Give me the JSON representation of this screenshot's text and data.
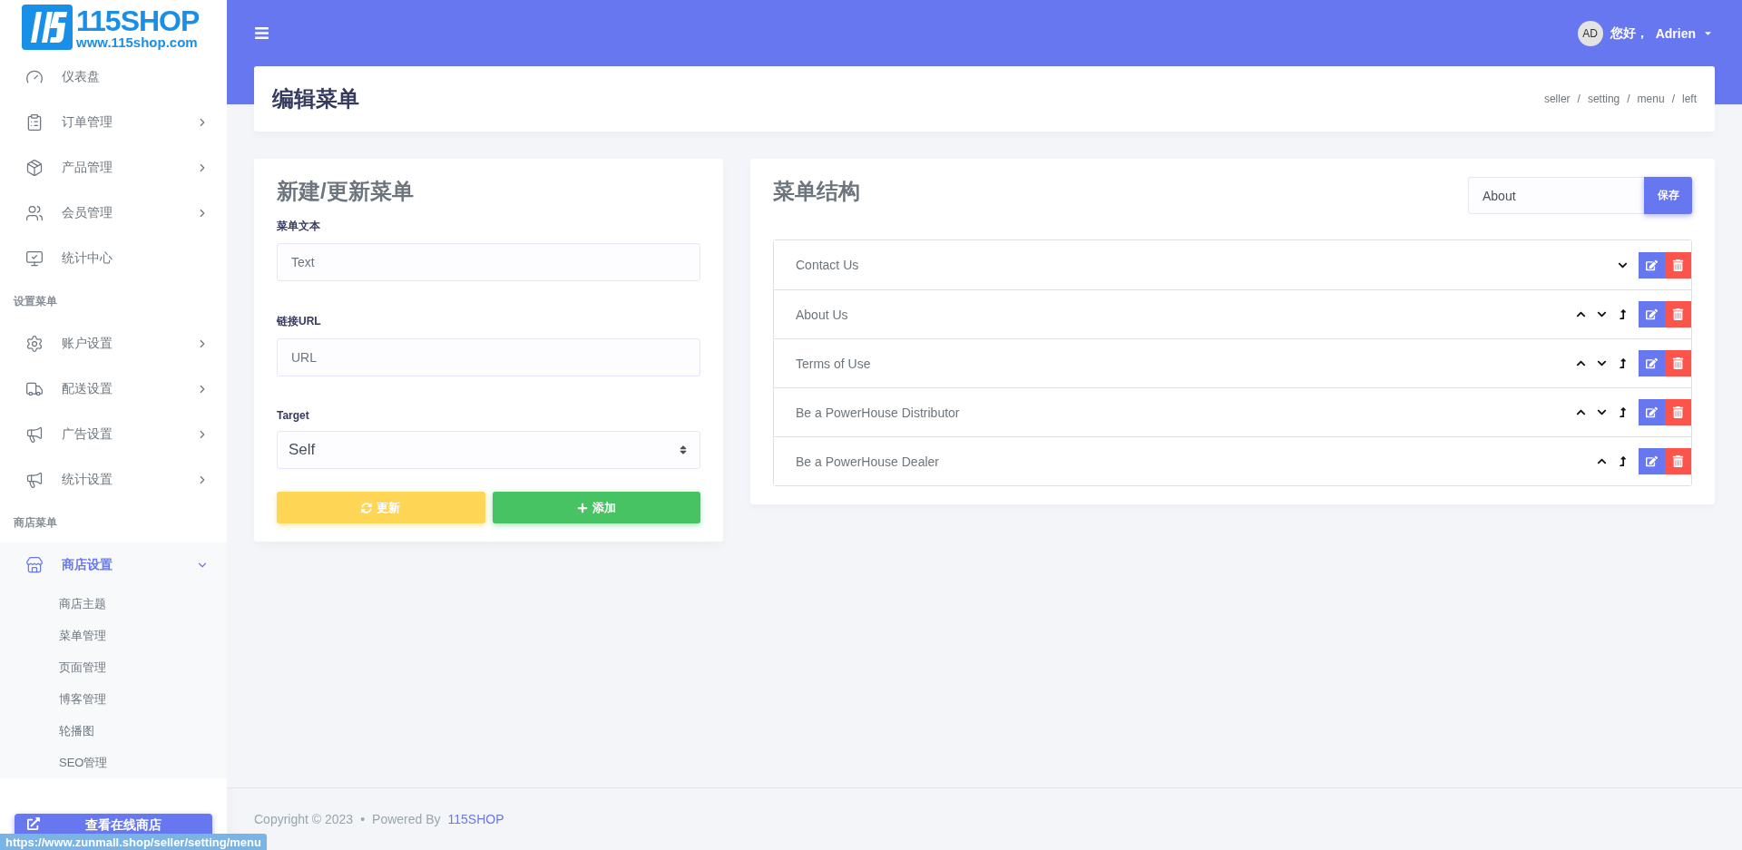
{
  "logo": {
    "brand": "115SHOP",
    "url": "www.115shop.com"
  },
  "sidebar": {
    "items": [
      {
        "kind": "item",
        "label": "仪表盘",
        "expandable": false,
        "selected": false
      },
      {
        "kind": "item",
        "label": "订单管理",
        "expandable": true,
        "expanded": false,
        "selected": false
      },
      {
        "kind": "item",
        "label": "产品管理",
        "expandable": true,
        "expanded": false,
        "selected": false
      },
      {
        "kind": "item",
        "label": "会员管理",
        "expandable": true,
        "expanded": false,
        "selected": false
      },
      {
        "kind": "item",
        "label": "统计中心",
        "expandable": false,
        "selected": false
      },
      {
        "kind": "section",
        "label": "设置菜单"
      },
      {
        "kind": "item",
        "label": "账户设置",
        "expandable": true,
        "expanded": false,
        "selected": false
      },
      {
        "kind": "item",
        "label": "配送设置",
        "expandable": true,
        "expanded": false,
        "selected": false
      },
      {
        "kind": "item",
        "label": "广告设置",
        "expandable": true,
        "expanded": false,
        "selected": false
      },
      {
        "kind": "item",
        "label": "统计设置",
        "expandable": true,
        "expanded": false,
        "selected": false
      },
      {
        "kind": "section",
        "label": "商店菜单"
      },
      {
        "kind": "item",
        "label": "商店设置",
        "expandable": true,
        "expanded": true,
        "selected": true,
        "children": [
          {
            "label": "商店主题"
          },
          {
            "label": "菜单管理"
          },
          {
            "label": "页面管理"
          },
          {
            "label": "博客管理"
          },
          {
            "label": "轮播图"
          },
          {
            "label": "SEO管理"
          }
        ]
      }
    ],
    "store_button": "查看在线商店"
  },
  "topbar": {
    "avatar": "AD",
    "greeting": "您好，",
    "user": "Adrien"
  },
  "page": {
    "title": "编辑菜单",
    "breadcrumb": [
      "seller",
      "setting",
      "menu",
      "left"
    ],
    "breadcrumb_separator": "/"
  },
  "form": {
    "title": "新建/更新菜单",
    "fields": [
      {
        "label": "菜单文本",
        "placeholder": "Text"
      },
      {
        "label": "链接URL",
        "placeholder": "URL"
      }
    ],
    "target": {
      "label": "Target",
      "value": "Self"
    },
    "update_button": "更新",
    "add_button": "添加"
  },
  "structure": {
    "title": "菜单结构",
    "name_value": "About",
    "save_button": "保存",
    "items": [
      {
        "label": "Contact Us",
        "move_up": false,
        "move_down": true,
        "outdent": false
      },
      {
        "label": "About Us",
        "move_up": true,
        "move_down": true,
        "outdent": true
      },
      {
        "label": "Terms of Use",
        "move_up": true,
        "move_down": true,
        "outdent": true
      },
      {
        "label": "Be a PowerHouse Distributor",
        "move_up": true,
        "move_down": true,
        "outdent": true
      },
      {
        "label": "Be a PowerHouse Dealer",
        "move_up": true,
        "move_down": false,
        "outdent": true
      }
    ]
  },
  "footer": {
    "copyright": "Copyright © 2023",
    "bullet": "•",
    "powered": "Powered By",
    "link": "115SHOP"
  },
  "status_url": "https://www.zunmall.shop/seller/setting/menu"
}
